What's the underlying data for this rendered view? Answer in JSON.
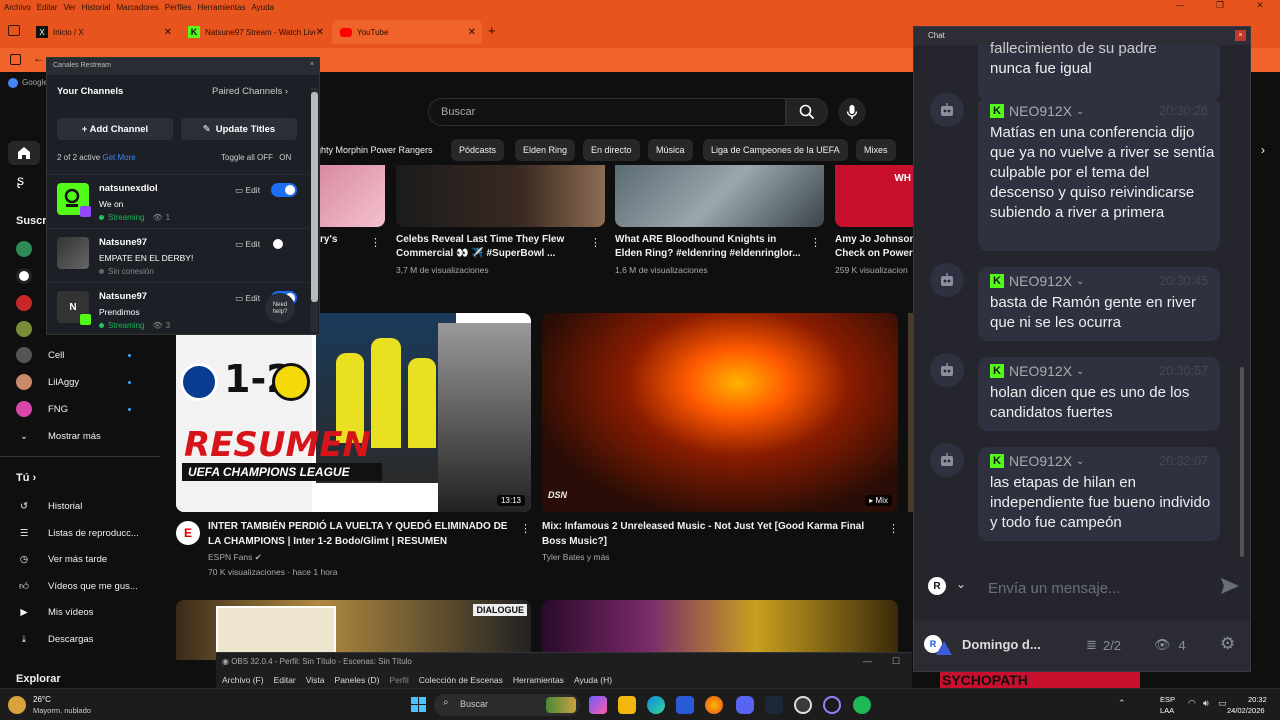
{
  "menubar": {
    "items": [
      "Archivo",
      "Editar",
      "Ver",
      "Historial",
      "Marcadores",
      "Perfiles",
      "Herramientas",
      "Ayuda"
    ]
  },
  "tabs": [
    {
      "label": "Inicio / X",
      "icon": "x-icon"
    },
    {
      "label": "Natsune97 Stream - Watch Live",
      "icon": "kick-icon"
    },
    {
      "label": "YouTube",
      "icon": "youtube-icon"
    }
  ],
  "bookmarks": {
    "first": "Google"
  },
  "youtube": {
    "search_placeholder": "Buscar",
    "chips": [
      "ighty Morphin Power Rangers",
      "Pódcasts",
      "Elden Ring",
      "En directo",
      "Música",
      "Liga de Campeones de la UEFA",
      "Mixes"
    ],
    "sidebar": {
      "subs_heading": "Suscri",
      "subs": [
        {
          "name": "Cell"
        },
        {
          "name": "LilAggy"
        },
        {
          "name": "FNG"
        }
      ],
      "show_more": "Mostrar más",
      "you_heading": "Tú",
      "you_items": [
        "Historial",
        "Listas de reproducc...",
        "Ver más tarde",
        "Vídeos que me gus...",
        "Mis vídeos",
        "Descargas"
      ],
      "explore": "Explorar"
    },
    "row1": [
      {
        "title_1": "ry's",
        "title_2": ""
      },
      {
        "title_1": "Celebs Reveal Last Time They Flew",
        "title_2": "Commercial 👀 ✈️ #SuperBowl ...",
        "meta": "3,7 M de visualizaciones"
      },
      {
        "title_1": "What ARE Bloodhound Knights in",
        "title_2": "Elden Ring? #eldenring #eldenringlor...",
        "meta": "1,6 M de visualizaciones"
      },
      {
        "title_1": "Amy Jo Johnson",
        "title_2": "Check on Power",
        "meta": "259 K visualizacion"
      }
    ],
    "row2": [
      {
        "title_1": "INTER TAMBIÉN PERDIÓ LA VUELTA Y QUEDÓ ELIMINADO DE",
        "title_2": "LA CHAMPIONS | Inter 1-2 Bodo/Glimt | RESUMEN",
        "channel": "ESPN Fans",
        "meta": "70 K visualizaciones · hace 1 hora",
        "duration": "13:13",
        "thumb_score": "1-2",
        "thumb_word": "RESUMEN",
        "thumb_sub": "UEFA CHAMPIONS LEAGUE"
      },
      {
        "title_1": "Mix: Infamous 2 Unreleased Music - Not Just Yet [Good Karma Final",
        "title_2": "Boss Music?]",
        "channel": "Tyler Bates y más",
        "badge": "Mix",
        "thumb_mark": "DSN"
      }
    ],
    "row3": {
      "thumb_word": "DIALOGUE"
    },
    "partial": {
      "thumb_word": "WH",
      "bottom_word": "SYCHOPATH"
    }
  },
  "restream": {
    "window_title": "Canales Restream",
    "your_channels": "Your Channels",
    "paired_channels": "Paired Channels",
    "add_channel": "+ Add Channel",
    "update_titles": "Update Titles",
    "active_count": "2 of 2 active",
    "get_more": "Get More",
    "toggle_all": "Toggle all",
    "off": "OFF",
    "on": "ON",
    "edit_label": "Edit",
    "need_help": "Need help?",
    "channels": [
      {
        "name": "natsunexdlol",
        "title": "We on",
        "status": "Streaming",
        "viewers": "1",
        "enabled": true
      },
      {
        "name": "Natsune97",
        "title": "EMPATE EN EL DERBY!",
        "status": "Sin conexión",
        "viewers": "",
        "enabled": false
      },
      {
        "name": "Natsune97",
        "title": "Prendimos",
        "status": "Streaming",
        "viewers": "3",
        "enabled": true,
        "avatar_letter": "N"
      }
    ]
  },
  "chat": {
    "title": "Chat",
    "top_text_1": "fallecimiento de su padre",
    "top_text_2": "nunca fue igual",
    "messages": [
      {
        "user": "NEO912X",
        "time": "20:30:26",
        "text": "Matías en una conferencia dijo que ya no vuelve a river se sentía culpable por el tema del descenso y quiso reivindicarse subiendo a river a primera"
      },
      {
        "user": "NEO912X",
        "time": "20:30:45",
        "text": "basta de Ramón gente en river que ni se les ocurra"
      },
      {
        "user": "NEO912X",
        "time": "20:30:57",
        "text": "holan dicen que es uno de los candidatos fuertes"
      },
      {
        "user": "NEO912X",
        "time": "20:32:07",
        "text": "las etapas de hilan en independiente fue bueno individo y todo fue campeón"
      }
    ],
    "input_placeholder": "Envía un mensaje...",
    "footer_name": "Domingo d...",
    "footer_channels": "2/2",
    "footer_viewers": "4"
  },
  "obs": {
    "title": "OBS 32.0.4 - Perfil: Sin Título - Escenas: Sin Título",
    "menus": [
      "Archivo (F)",
      "Editar",
      "Vista",
      "Paneles (D)",
      "Perfil",
      "Colección de Escenas",
      "Herramientas",
      "Ayuda (H)"
    ]
  },
  "taskbar": {
    "weather_temp": "26°C",
    "weather_desc": "Mayorm. nublado",
    "search": "Buscar",
    "lang_1": "ESP",
    "lang_2": "LAA",
    "time": "20:32",
    "date": "24/02/2026"
  },
  "colors": {
    "browser_accent": "#e8541e",
    "kick_green": "#53fc18",
    "toggle_on": "#1d6ef5"
  }
}
